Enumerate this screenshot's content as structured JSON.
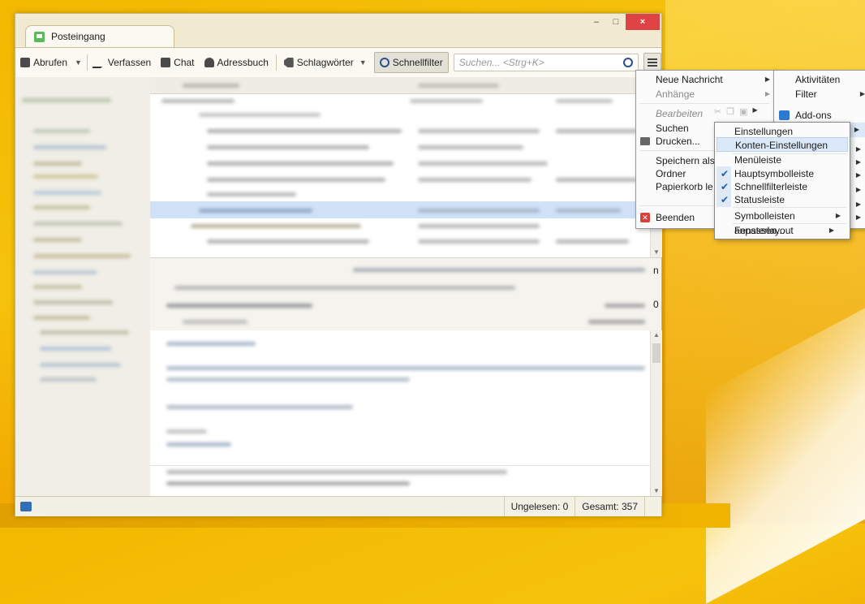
{
  "window": {
    "tab_title": "Posteingang",
    "controls": {
      "minimize": "–",
      "maximize": "□",
      "close": "×"
    }
  },
  "toolbar": {
    "get_mail": "Abrufen",
    "compose": "Verfassen",
    "chat": "Chat",
    "address_book": "Adressbuch",
    "tags": "Schlagwörter",
    "quick_filter": "Schnellfilter",
    "search_placeholder": "Suchen... <Strg+K>"
  },
  "app_menu": {
    "new_message": "Neue Nachricht",
    "attachments": "Anhänge",
    "edit": "Bearbeiten",
    "search": "Suchen",
    "print": "Drucken...",
    "save_as": "Speichern als",
    "folder": "Ordner",
    "empty_trash": "Papierkorb leeren",
    "quit": "Beenden"
  },
  "right_menu": {
    "activities": "Aktivitäten",
    "filter": "Filter",
    "addons": "Add-ons"
  },
  "settings_submenu": {
    "settings": "Einstellungen",
    "account_settings": "Konten-Einstellungen",
    "menubar": "Menüleiste",
    "main_toolbar": "Hauptsymbolleiste",
    "quickfilter_bar": "Schnellfilterleiste",
    "status_bar": "Statusleiste",
    "customize": "Symbolleisten anpassen...",
    "layout": "Fensterlayout"
  },
  "status": {
    "unread": "Ungelesen: 0",
    "total": "Gesamt: 357"
  },
  "preview_fragments": {
    "a": "n",
    "b": "0"
  },
  "colors": {
    "accent": "#cfe2f7",
    "close": "#e04343",
    "check": "#1b5fb3"
  }
}
